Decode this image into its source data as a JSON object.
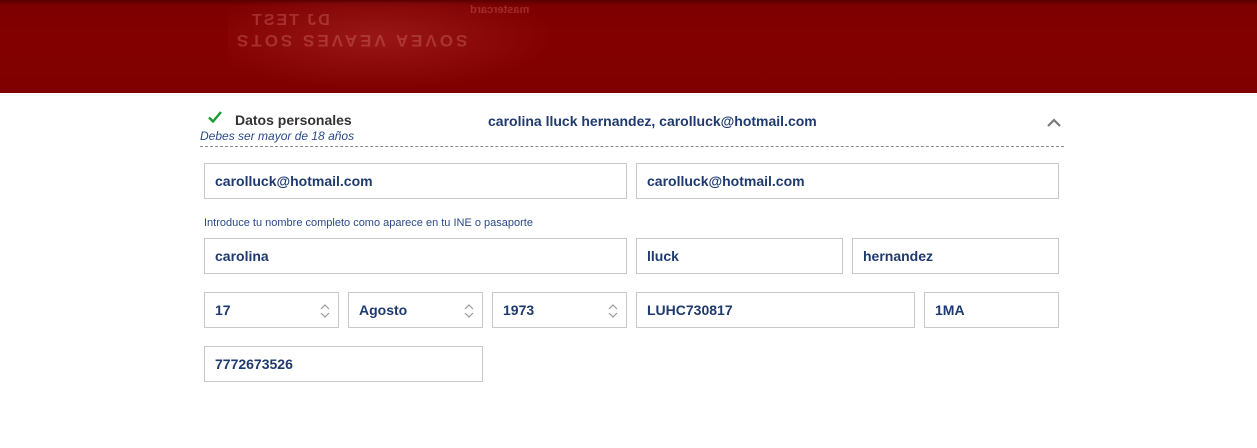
{
  "banner": {
    "ghost_line_1": "DJ TEST",
    "ghost_line_2": "SOVEA VEAVES SOTS",
    "ghost_line_3": "mastercard"
  },
  "section": {
    "title": "Datos personales",
    "subtitle": "Debes ser mayor de 18 años",
    "summary": "carolina lluck hernandez, carolluck@hotmail.com",
    "status_color": "#1a9c2e"
  },
  "form": {
    "email": "carolluck@hotmail.com",
    "email_confirm": "carolluck@hotmail.com",
    "name_hint": "Introduce tu nombre completo como aparece en tu INE o pasaporte",
    "first_name": "carolina",
    "last_name_1": "lluck",
    "last_name_2": "hernandez",
    "birth_day": "17",
    "birth_month": "Agosto",
    "birth_year": "1973",
    "rfc": "LUHC730817",
    "homoclave": "1MA",
    "phone": "7772673526"
  },
  "icons": {
    "check": "checkmark-icon",
    "collapse": "chevron-up-icon",
    "select": "updown-arrows-icon"
  }
}
